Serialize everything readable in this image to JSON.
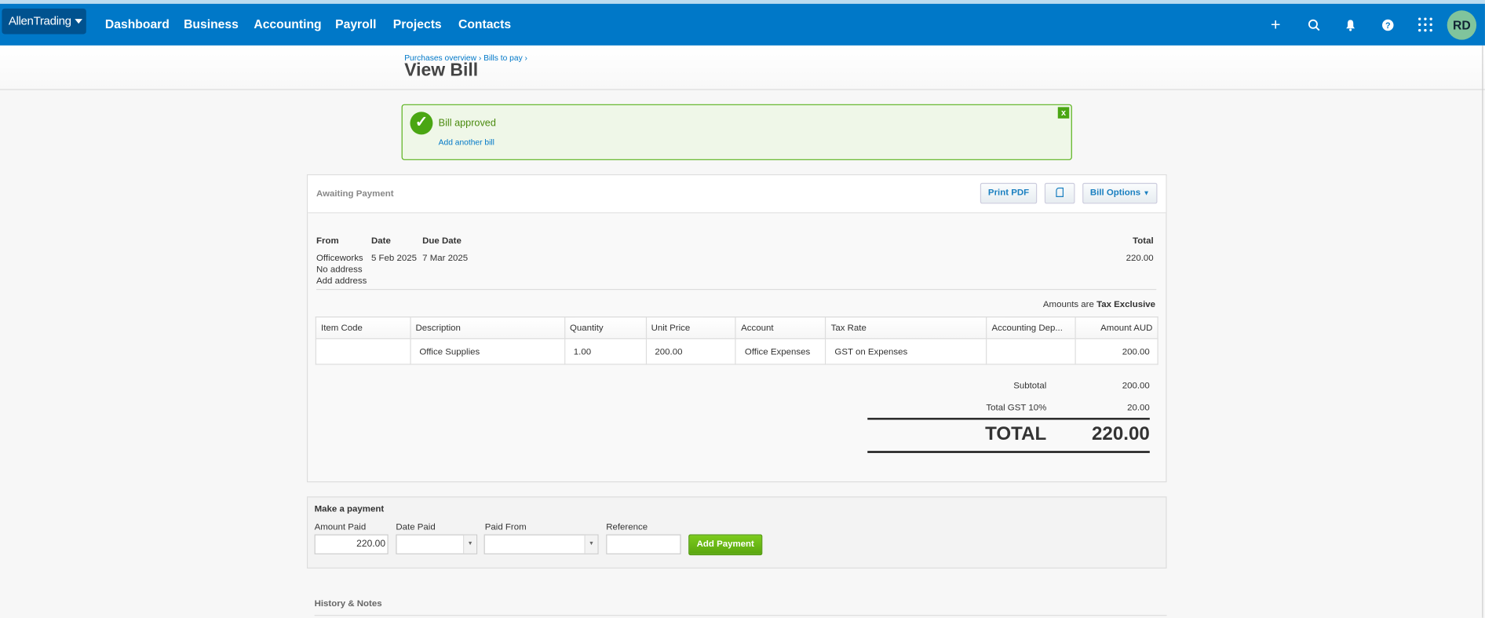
{
  "nav": {
    "org": "AllenTrading",
    "items": [
      "Dashboard",
      "Business",
      "Accounting",
      "Payroll",
      "Projects",
      "Contacts"
    ],
    "avatar": "RD"
  },
  "header": {
    "breadcrumb": "Purchases overview › Bills to pay ›",
    "title": "View Bill"
  },
  "alert": {
    "message": "Bill approved",
    "link": "Add another bill"
  },
  "bill": {
    "status": "Awaiting Payment",
    "buttons": {
      "print": "Print PDF",
      "options": "Bill Options"
    },
    "labels": {
      "from": "From",
      "date": "Date",
      "due": "Due Date",
      "total": "Total"
    },
    "from": "Officeworks",
    "no_address": "No address",
    "add_address": "Add address",
    "date": "5 Feb 2025",
    "due": "7 Mar 2025",
    "total": "220.00",
    "amounts_prefix": "Amounts are",
    "amounts_mode": "Tax Exclusive",
    "columns": [
      "Item Code",
      "Description",
      "Quantity",
      "Unit Price",
      "Account",
      "Tax Rate",
      "Accounting Dep...",
      "Amount AUD"
    ],
    "rows": [
      [
        "",
        "Office Supplies",
        "1.00",
        "200.00",
        "Office Expenses",
        "GST on Expenses",
        "",
        "200.00"
      ]
    ],
    "subtotal_label": "Subtotal",
    "subtotal": "200.00",
    "gst_label": "Total GST  10%",
    "gst": "20.00",
    "grand_label": "TOTAL",
    "grand": "220.00"
  },
  "payment": {
    "title": "Make a payment",
    "amount_label": "Amount Paid",
    "amount": "220.00",
    "date_label": "Date Paid",
    "from_label": "Paid From",
    "ref_label": "Reference",
    "button": "Add Payment"
  },
  "history": "History & Notes"
}
